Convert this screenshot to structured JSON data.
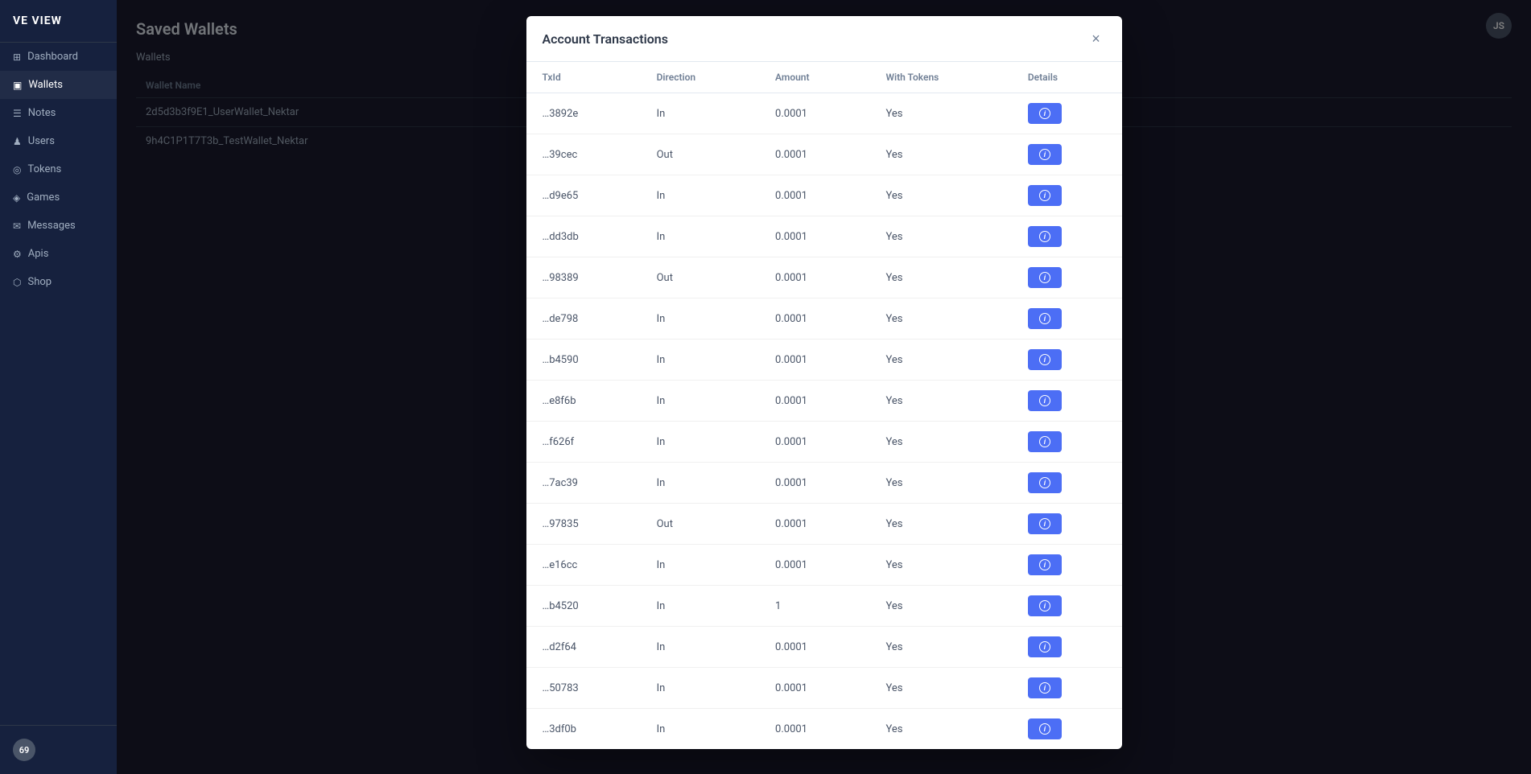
{
  "app": {
    "title": "VE VIEW"
  },
  "sidebar": {
    "logo": "VE VIEW",
    "items": [
      {
        "id": "dashboard",
        "label": "Dashboard",
        "icon": "⊞",
        "active": false
      },
      {
        "id": "wallets",
        "label": "Wallets",
        "icon": "▣",
        "active": true
      },
      {
        "id": "notes",
        "label": "Notes",
        "icon": "☰",
        "active": false
      },
      {
        "id": "users",
        "label": "Users",
        "icon": "♟",
        "active": false
      },
      {
        "id": "tokens",
        "label": "Tokens",
        "icon": "◎",
        "active": false
      },
      {
        "id": "games",
        "label": "Games",
        "icon": "◈",
        "active": false
      },
      {
        "id": "messages",
        "label": "Messages",
        "icon": "✉",
        "active": false
      },
      {
        "id": "apis",
        "label": "Apis",
        "icon": "⚙",
        "active": false
      },
      {
        "id": "shop",
        "label": "Shop",
        "icon": "⬡",
        "active": false
      }
    ],
    "bottom_label": "69"
  },
  "top_bar": {
    "avatar_initials": "JS"
  },
  "page": {
    "title": "Saved Wallets",
    "section_label": "Wallets",
    "wallet_col_name": "Wallet Name",
    "wallets": [
      {
        "name": "2d5d3b3f9E1_UserWallet_Nektar"
      },
      {
        "name": "9h4C1P1T7T3b_TestWallet_Nektar"
      }
    ]
  },
  "modal": {
    "title": "Account Transactions",
    "close_label": "×",
    "columns": [
      "TxId",
      "Direction",
      "Amount",
      "With Tokens",
      "Details"
    ],
    "details_button_label": "ⓘ",
    "transactions": [
      {
        "txid": "…3892e",
        "direction": "In",
        "amount": "0.0001",
        "with_tokens": "Yes"
      },
      {
        "txid": "…39cec",
        "direction": "Out",
        "amount": "0.0001",
        "with_tokens": "Yes"
      },
      {
        "txid": "…d9e65",
        "direction": "In",
        "amount": "0.0001",
        "with_tokens": "Yes"
      },
      {
        "txid": "…dd3db",
        "direction": "In",
        "amount": "0.0001",
        "with_tokens": "Yes"
      },
      {
        "txid": "…98389",
        "direction": "Out",
        "amount": "0.0001",
        "with_tokens": "Yes"
      },
      {
        "txid": "…de798",
        "direction": "In",
        "amount": "0.0001",
        "with_tokens": "Yes"
      },
      {
        "txid": "…b4590",
        "direction": "In",
        "amount": "0.0001",
        "with_tokens": "Yes"
      },
      {
        "txid": "…e8f6b",
        "direction": "In",
        "amount": "0.0001",
        "with_tokens": "Yes"
      },
      {
        "txid": "…f626f",
        "direction": "In",
        "amount": "0.0001",
        "with_tokens": "Yes"
      },
      {
        "txid": "…7ac39",
        "direction": "In",
        "amount": "0.0001",
        "with_tokens": "Yes"
      },
      {
        "txid": "…97835",
        "direction": "Out",
        "amount": "0.0001",
        "with_tokens": "Yes"
      },
      {
        "txid": "…e16cc",
        "direction": "In",
        "amount": "0.0001",
        "with_tokens": "Yes"
      },
      {
        "txid": "…b4520",
        "direction": "In",
        "amount": "1",
        "with_tokens": "Yes"
      },
      {
        "txid": "…d2f64",
        "direction": "In",
        "amount": "0.0001",
        "with_tokens": "Yes"
      },
      {
        "txid": "…50783",
        "direction": "In",
        "amount": "0.0001",
        "with_tokens": "Yes"
      },
      {
        "txid": "…3df0b",
        "direction": "In",
        "amount": "0.0001",
        "with_tokens": "Yes"
      }
    ]
  }
}
